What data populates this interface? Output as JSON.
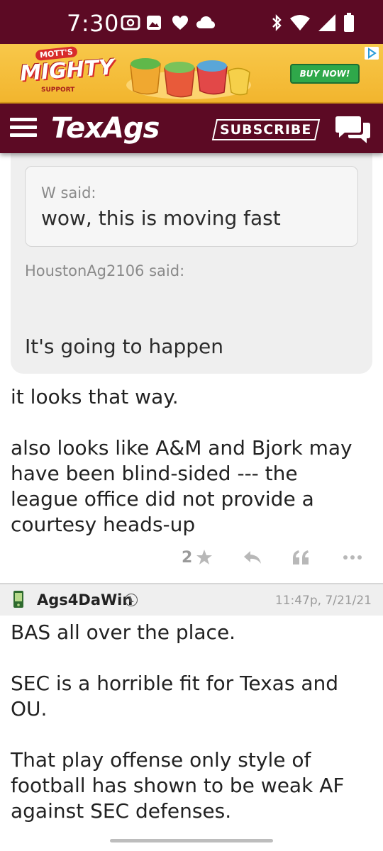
{
  "status_bar": {
    "time": "7:30",
    "left_icons": [
      "cast-icon",
      "image-icon",
      "heart-icon",
      "cloud-icon"
    ],
    "right_icons": [
      "bluetooth-icon",
      "wifi-icon",
      "signal-icon",
      "battery-icon"
    ]
  },
  "ad": {
    "brand_top": "MOTT'S",
    "brand": "MIGHTY",
    "brand_sub": "SUPPORT",
    "cta": "BUY NOW!",
    "colors": {
      "background": "#f5bd38",
      "cta": "#2fa84a",
      "brand_red": "#d82b2b"
    }
  },
  "header": {
    "logo": "TexAgs",
    "subscribe_label": "SUBSCRIBE",
    "color": "#5c0a24"
  },
  "quoted_post": {
    "inner_quote": {
      "author": "W said:",
      "text": "wow, this is moving fast"
    },
    "author": "HoustonAg2106 said:",
    "text": "It's going to happen"
  },
  "reply": {
    "paragraphs": [
      "it looks that way.",
      "also looks like A&M and Bjork may have been blind-sided --- the league office did not provide a courtesy heads-up"
    ],
    "likes": "2"
  },
  "next_post": {
    "username": "Ags4DaWin",
    "badge": "L",
    "timestamp": "11:47p, 7/21/21",
    "paragraphs": [
      "BAS all over the place.",
      "SEC is a horrible fit for Texas and OU.",
      "That play offense only style of football has shown to be weak AF against SEC defenses."
    ]
  }
}
